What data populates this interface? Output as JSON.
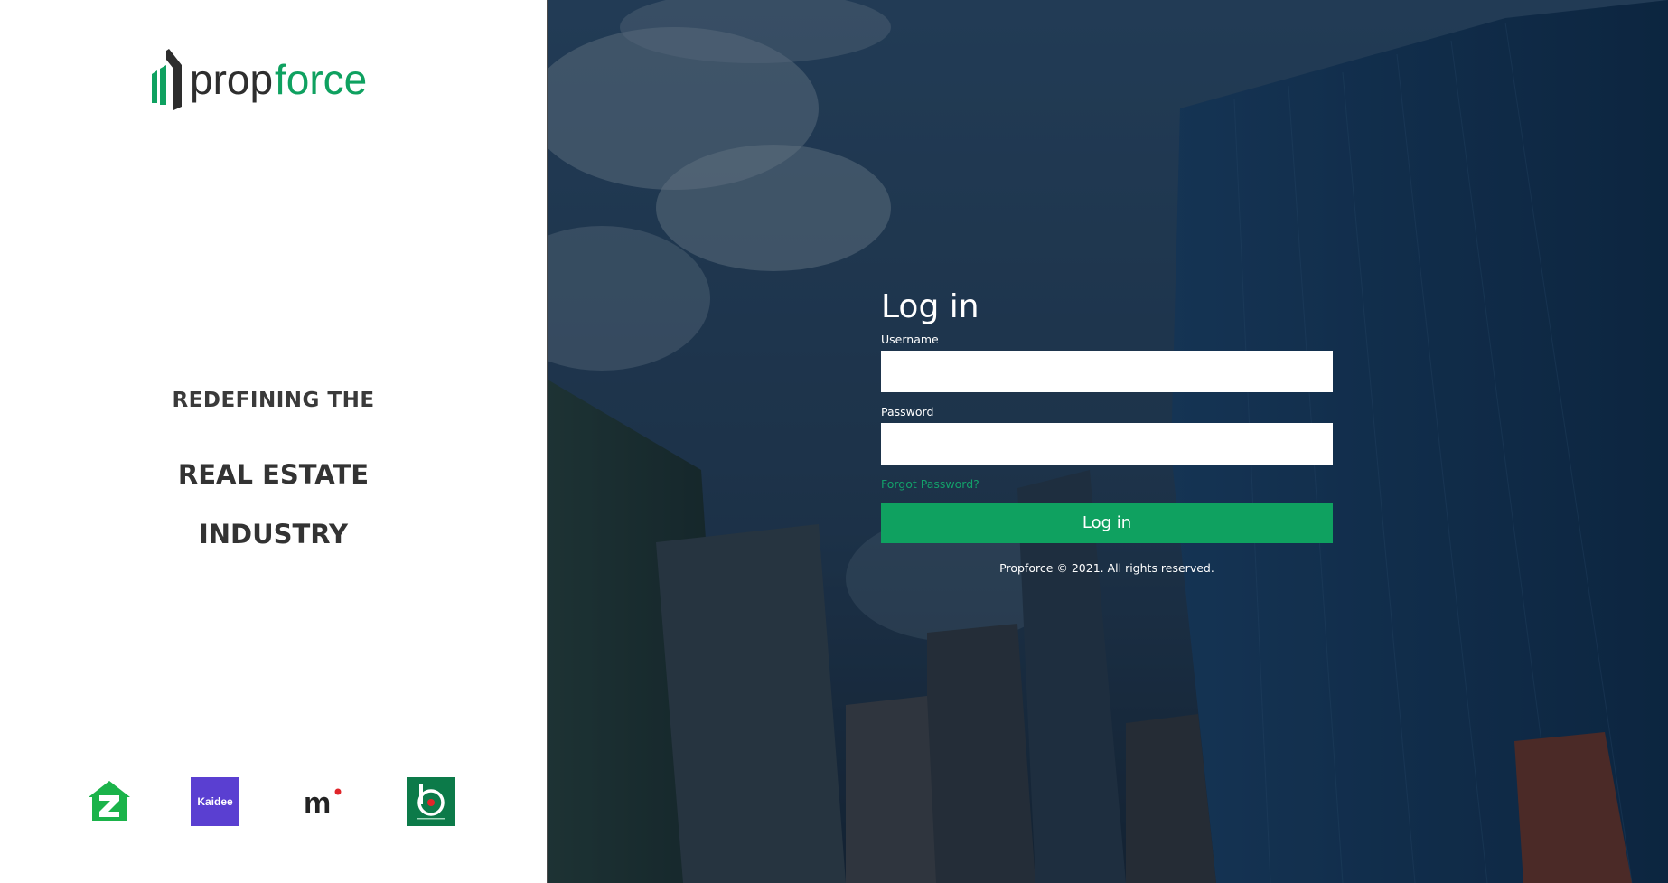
{
  "brand": {
    "name": "propforce",
    "name_part1": "prop",
    "name_part2": "force",
    "accent": "#0fa160"
  },
  "tagline": {
    "line1": "REDEFINING THE",
    "line2a": "REAL ESTATE",
    "line2b": "INDUSTRY"
  },
  "partners": [
    {
      "name": "zameen-logo",
      "color": "#1bb34a"
    },
    {
      "name": "kaidee-logo",
      "label": "Kaidee",
      "color": "#5a3fd1"
    },
    {
      "name": "mudah-logo",
      "label": "m",
      "color": "#222222"
    },
    {
      "name": "bahtsold-logo",
      "label": "b",
      "color": "#0c7a49"
    }
  ],
  "login": {
    "title": "Log in",
    "username_label": "Username",
    "username_value": "",
    "password_label": "Password",
    "password_value": "",
    "forgot_label": "Forgot Password?",
    "submit_label": "Log in",
    "copyright": "Propforce © 2021. All rights reserved."
  }
}
